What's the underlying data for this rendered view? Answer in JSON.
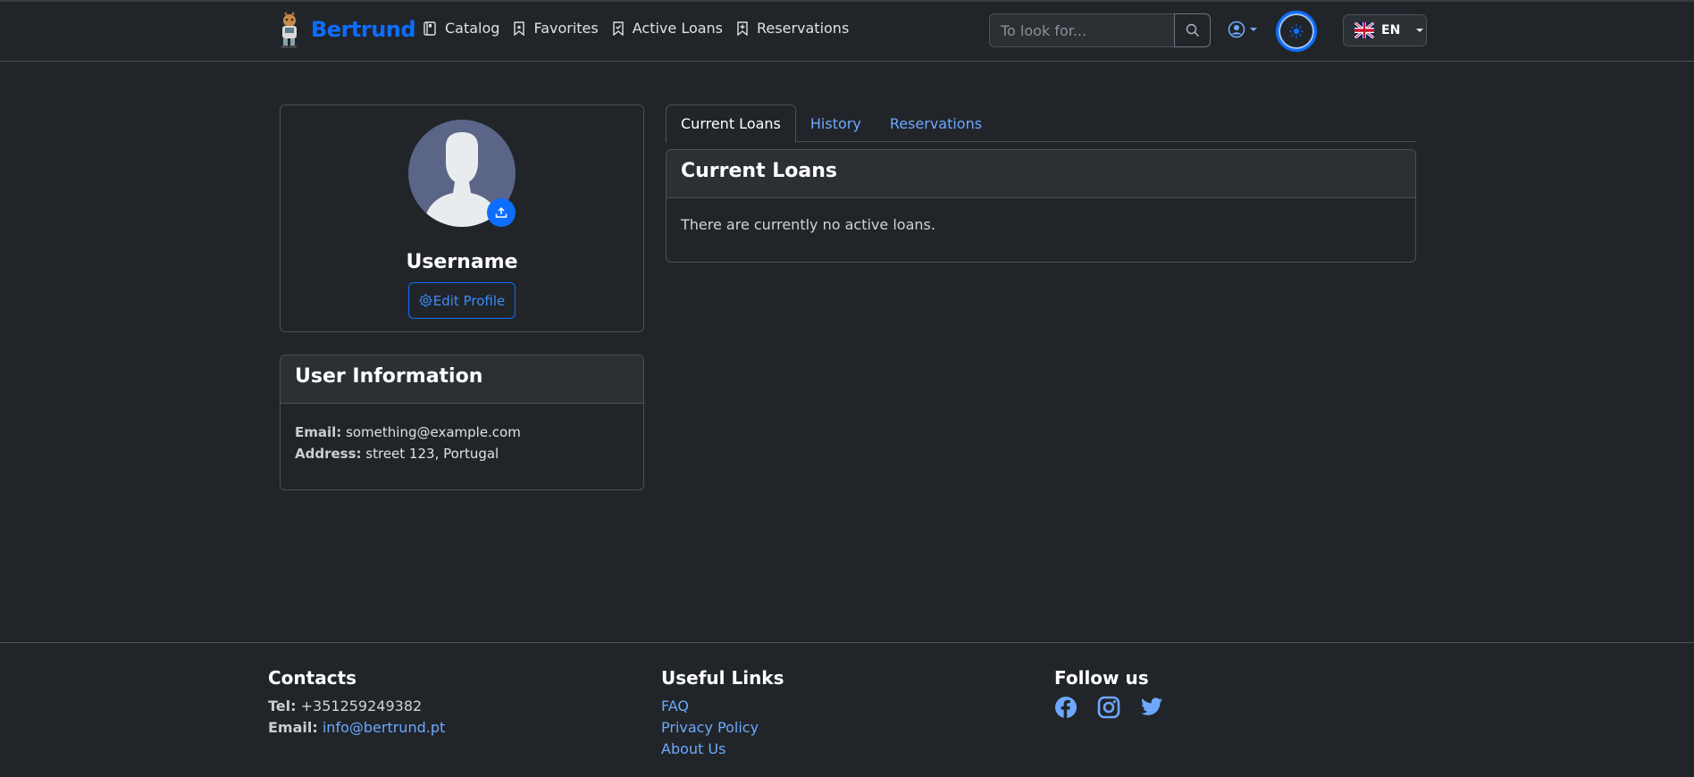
{
  "brand": {
    "name": "Bertrund"
  },
  "nav": {
    "items": [
      {
        "label": "Catalog",
        "icon": "book-icon"
      },
      {
        "label": "Favorites",
        "icon": "bookmark-icon"
      },
      {
        "label": "Active Loans",
        "icon": "bookmark-check-icon"
      },
      {
        "label": "Reservations",
        "icon": "bookmark-plus-icon"
      }
    ],
    "search_placeholder": "To look for...",
    "language": "EN"
  },
  "profile": {
    "username": "Username",
    "edit_label": "Edit Profile"
  },
  "user_info": {
    "title": "User Information",
    "email_label": "Email:",
    "email": "something@example.com",
    "address_label": "Address:",
    "address": "street 123, Portugal"
  },
  "tabs": [
    {
      "label": "Current Loans",
      "active": true
    },
    {
      "label": "History",
      "active": false
    },
    {
      "label": "Reservations",
      "active": false
    }
  ],
  "loans": {
    "title": "Current Loans",
    "empty_text": "There are currently no active loans."
  },
  "footer": {
    "contacts": {
      "title": "Contacts",
      "tel_label": "Tel:",
      "tel": "+351259249382",
      "email_label": "Email:",
      "email": "info@bertrund.pt"
    },
    "links": {
      "title": "Useful Links",
      "items": [
        "FAQ",
        "Privacy Policy",
        "About Us"
      ]
    },
    "follow": {
      "title": "Follow us",
      "icons": [
        "facebook-icon",
        "instagram-icon",
        "twitter-icon"
      ]
    }
  },
  "colors": {
    "background": "#212529",
    "primary": "#0d6efd",
    "link": "#6ea8fe",
    "border": "#495057"
  }
}
